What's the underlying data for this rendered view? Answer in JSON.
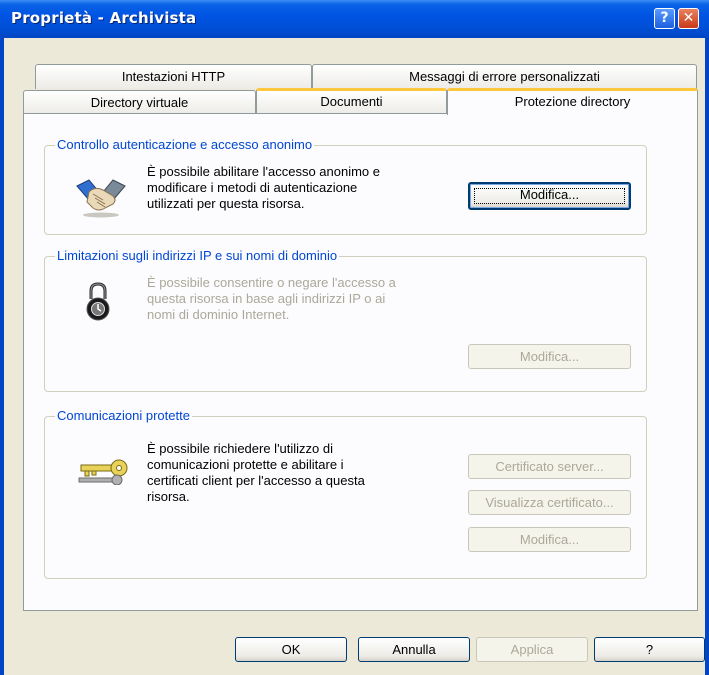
{
  "window": {
    "title": "Proprietà - Archivista"
  },
  "titlebar_buttons": {
    "help": "?",
    "close": "✕"
  },
  "tabs_back": [
    {
      "label": "Intestazioni HTTP"
    },
    {
      "label": "Messaggi di errore personalizzati"
    }
  ],
  "tabs_front": [
    {
      "label": "Directory virtuale"
    },
    {
      "label": "Documenti"
    },
    {
      "label": "Protezione directory",
      "active": true
    }
  ],
  "groups": {
    "auth": {
      "title": "Controllo autenticazione e accesso anonimo",
      "lines": [
        "È possibile abilitare l'accesso anonimo e",
        "modificare i metodi di autenticazione",
        "utilizzati per questa risorsa."
      ],
      "button": "Modifica..."
    },
    "ip": {
      "title": "Limitazioni sugli indirizzi IP e sui nomi di dominio",
      "lines": [
        "È possibile consentire o negare l'accesso a",
        "questa risorsa in base agli indirizzi IP o ai",
        "nomi di dominio Internet."
      ],
      "button": "Modifica..."
    },
    "secure": {
      "title": "Comunicazioni protette",
      "lines": [
        "È possibile richiedere l'utilizzo di",
        "comunicazioni protette e abilitare i",
        "certificati client per l'accesso a questa",
        "risorsa."
      ],
      "buttons": {
        "server_cert": "Certificato server...",
        "view_cert": "Visualizza certificato...",
        "edit": "Modifica..."
      }
    }
  },
  "footer": {
    "ok": "OK",
    "cancel": "Annulla",
    "apply": "Applica",
    "help": "?"
  },
  "icons": {
    "help": "help-icon",
    "close": "close-icon",
    "auth": "handshake-icon",
    "ip": "padlock-icon",
    "secure": "key-icon"
  }
}
